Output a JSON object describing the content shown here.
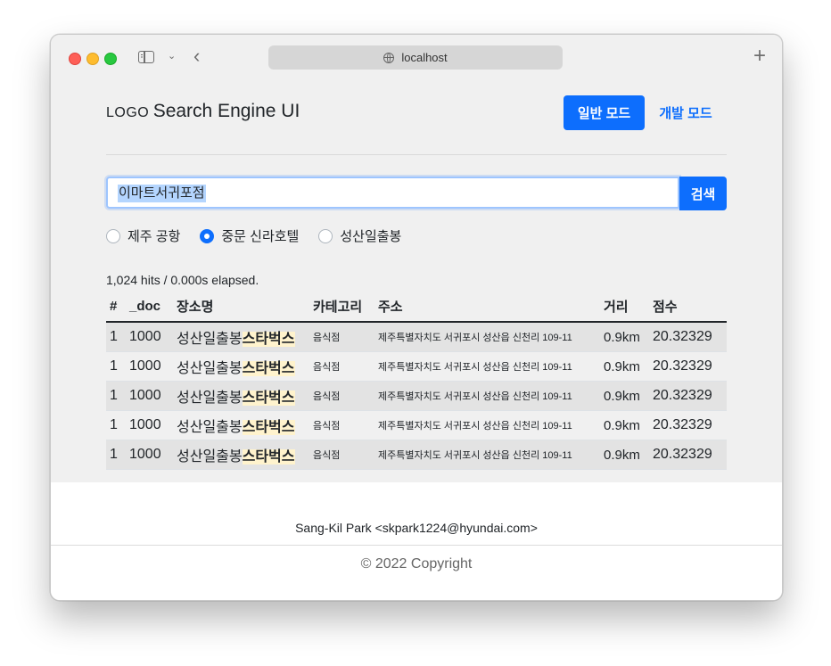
{
  "browser": {
    "url": "localhost"
  },
  "header": {
    "logo_small": "LOGO",
    "logo_title": "Search Engine UI",
    "mode_normal": "일반 모드",
    "mode_dev": "개발 모드"
  },
  "search": {
    "query": "이마트서귀포점",
    "button": "검색"
  },
  "radios": [
    {
      "label": "제주 공항",
      "checked": false
    },
    {
      "label": "중문 신라호텔",
      "checked": true
    },
    {
      "label": "성산일출봉",
      "checked": false
    }
  ],
  "results": {
    "summary": "1,024 hits / 0.000s elapsed.",
    "columns": [
      "#",
      "_doc",
      "장소명",
      "카테고리",
      "주소",
      "거리",
      "점수"
    ],
    "rows": [
      {
        "num": "1",
        "doc": "1000",
        "name_plain": "성산일출봉",
        "name_hl": "스타벅스",
        "category": "음식점",
        "address": "제주특별자치도 서귀포시 성산읍 신천리 109-11",
        "distance": "0.9km",
        "score": "20.32329"
      },
      {
        "num": "1",
        "doc": "1000",
        "name_plain": "성산일출봉",
        "name_hl": "스타벅스",
        "category": "음식점",
        "address": "제주특별자치도 서귀포시 성산읍 신천리 109-11",
        "distance": "0.9km",
        "score": "20.32329"
      },
      {
        "num": "1",
        "doc": "1000",
        "name_plain": "성산일출봉",
        "name_hl": "스타벅스",
        "category": "음식점",
        "address": "제주특별자치도 서귀포시 성산읍 신천리 109-11",
        "distance": "0.9km",
        "score": "20.32329"
      },
      {
        "num": "1",
        "doc": "1000",
        "name_plain": "성산일출봉",
        "name_hl": "스타벅스",
        "category": "음식점",
        "address": "제주특별자치도 서귀포시 성산읍 신천리 109-11",
        "distance": "0.9km",
        "score": "20.32329"
      },
      {
        "num": "1",
        "doc": "1000",
        "name_plain": "성산일출봉",
        "name_hl": "스타벅스",
        "category": "음식점",
        "address": "제주특별자치도 서귀포시 성산읍 신천리 109-11",
        "distance": "0.9km",
        "score": "20.32329"
      }
    ]
  },
  "footer": {
    "author": "Sang-Kil Park <skpark1224@hyundai.com>",
    "copyright": "© 2022 Copyright"
  },
  "colors": {
    "primary": "#0d6efd",
    "highlight": "#fff3cd"
  }
}
